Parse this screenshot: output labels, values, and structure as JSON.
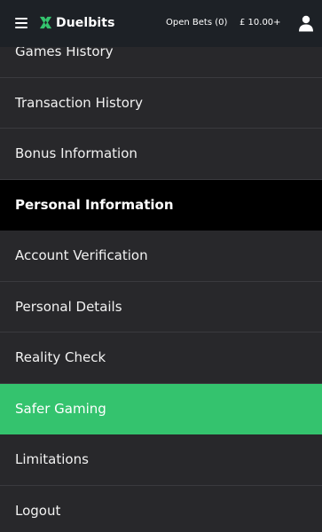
{
  "header": {
    "brand": "Duelbits",
    "open_bets": "Open Bets (0)",
    "balance": "£ 10.00+",
    "accent_color": "#34c36e"
  },
  "menu": {
    "items": [
      {
        "label": "Games History"
      },
      {
        "label": "Transaction History"
      },
      {
        "label": "Bonus Information"
      },
      {
        "label": "Personal Information",
        "state": "active"
      },
      {
        "label": "Account Verification"
      },
      {
        "label": "Personal Details"
      },
      {
        "label": "Reality Check"
      },
      {
        "label": "Safer Gaming",
        "state": "highlighted"
      },
      {
        "label": "Limitations"
      },
      {
        "label": "Logout"
      }
    ]
  },
  "icons": {
    "menu": "hamburger-icon",
    "logo": "duelbits-logo-icon",
    "account": "user-icon"
  }
}
